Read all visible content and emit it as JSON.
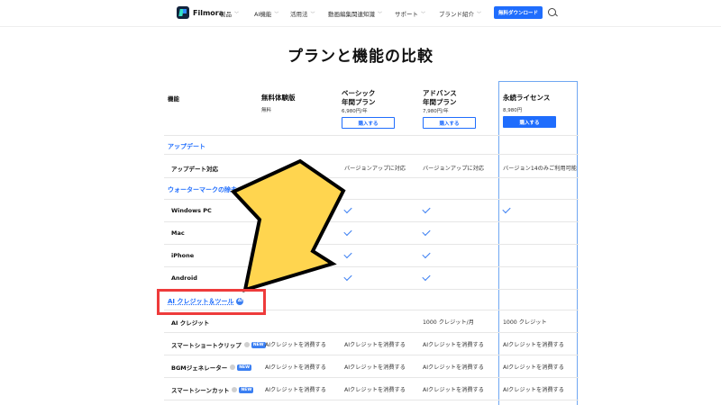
{
  "header": {
    "logo_text": "Filmora",
    "nav": [
      {
        "label": "製品"
      },
      {
        "label": "AI機能"
      },
      {
        "label": "活用法"
      },
      {
        "label": "動画編集関連知識"
      },
      {
        "label": "サポート"
      },
      {
        "label": "ブランド紹介"
      }
    ],
    "cta_label": "無料ダウンロード"
  },
  "page_title": "プランと機能の比較",
  "table": {
    "feature_header": "機能",
    "plans": [
      {
        "name_line1": "無料体験版",
        "name_line2": "",
        "price": "無料",
        "button": ""
      },
      {
        "name_line1": "ベーシック",
        "name_line2": "年間プラン",
        "price": "6,980円/年",
        "button": "購入する"
      },
      {
        "name_line1": "アドバンス",
        "name_line2": "年間プラン",
        "price": "7,980円/年",
        "button": "購入する"
      },
      {
        "name_line1": "永続ライセンス",
        "name_line2": "",
        "price": "8,980円",
        "button": "購入する"
      }
    ],
    "sections": {
      "update": "アップデート",
      "watermark": "ウォーターマークの除去",
      "ai": "AI クレジット＆ツール"
    },
    "ai_badge": "AI",
    "rows": {
      "update": {
        "label": "アップデート対応",
        "basic": "バージョンアップに対応",
        "advance": "バージョンアップに対応",
        "perpetual": "バージョン14のみご利用可能"
      },
      "windows": {
        "label": "Windows PC"
      },
      "mac": {
        "label": "Mac"
      },
      "iphone": {
        "label": "iPhone"
      },
      "android": {
        "label": "Android"
      },
      "ai_credit": {
        "label": "AI クレジット",
        "advance": "1000 クレジット/月",
        "perpetual": "1000 クレジット"
      },
      "smart_short": {
        "label": "スマートショートクリップ",
        "badge": "NEW",
        "free": "AIクレジットを消費する",
        "basic": "AIクレジットを消費する",
        "advance": "AIクレジットを消費する",
        "perpetual": "AIクレジットを消費する"
      },
      "bgm": {
        "label": "BGMジェネレーター",
        "badge": "NEW",
        "free": "AIクレジットを消費する",
        "basic": "AIクレジットを消費する",
        "advance": "AIクレジットを消費する",
        "perpetual": "AIクレジットを消費する"
      },
      "smart_scene": {
        "label": "スマートシーンカット",
        "badge": "NEW",
        "free": "AIクレジットを消費する",
        "basic": "AIクレジットを消費する",
        "advance": "AIクレジットを消費する",
        "perpetual": "AIクレジットを消費する"
      }
    }
  },
  "colors": {
    "accent": "#1f6dfd",
    "annotation_box": "#ee3b3b",
    "annotation_arrow": "#ffd54f"
  }
}
